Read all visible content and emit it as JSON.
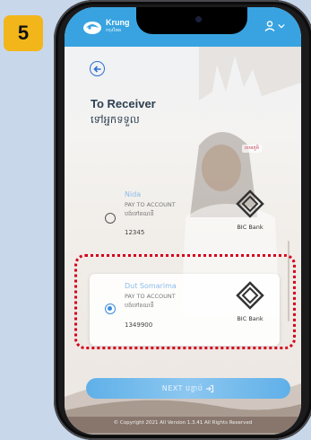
{
  "step": {
    "number": "5",
    "color": "#f2b61b"
  },
  "header": {
    "logo_text": "Krung",
    "logo_subtext": "กรุงไทย",
    "user_icon": "user-icon",
    "dropdown_icon": "chevron-down-icon",
    "bar_color": "#38a3e0"
  },
  "page": {
    "back_icon": "back-arrow-icon",
    "title": "To Receiver",
    "subtitle": "ទៅអ្នកទទួល"
  },
  "promo_tag": "ខេមរភូមិ",
  "receivers": [
    {
      "name": "Nida",
      "type": "PAY TO ACCOUNT",
      "type_km": "បង់ទៅគណនី",
      "account": "12345",
      "bank": "BIC Bank",
      "selected": false
    },
    {
      "name": "Dut Somarima",
      "type": "PAY TO ACCOUNT",
      "type_km": "បង់ទៅគណនី",
      "account": "1349900",
      "bank": "BIC Bank",
      "selected": true
    }
  ],
  "next_button": {
    "label": "NEXT បន្ទាប់",
    "icon": "sign-in-arrow-icon"
  },
  "footer": "© Copyright 2021 All Version 1.3.41 All Rights Reserved",
  "highlight_color": "#d5001c"
}
